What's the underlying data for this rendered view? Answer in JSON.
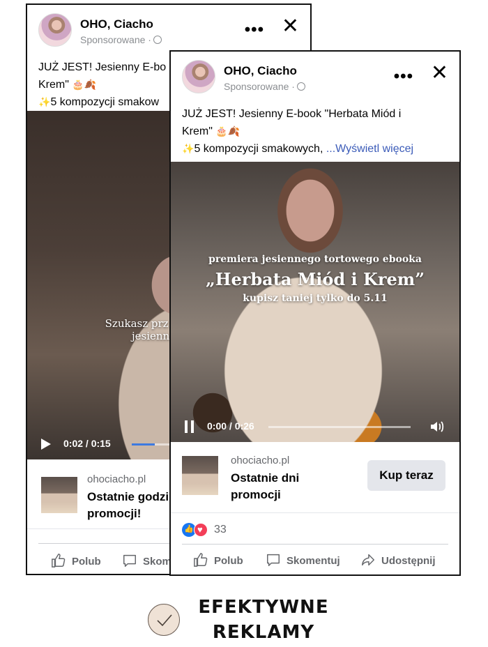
{
  "back_card": {
    "page_name": "OHO, Ciacho",
    "sponsored": "Sponsorowane ·",
    "caption_line1": "JUŻ JEST! Jesienny E-bo",
    "caption_line2": "Krem\"",
    "caption_line3": "5 kompozycji smakow",
    "video_overlay_1": "Szukasz prz",
    "video_overlay_2": "jesienn",
    "video_time": "0:02 / 0:15",
    "video_progress": 0.13,
    "cta_domain": "ohociacho.pl",
    "cta_title": "Ostatnie godzi promocji!",
    "actions": {
      "like": "Polub",
      "comment": "Skom"
    }
  },
  "front_card": {
    "page_name": "OHO, Ciacho",
    "sponsored": "Sponsorowane ·",
    "caption_line1": "JUŻ JEST! Jesienny E-book \"Herbata Miód i",
    "caption_line2": "Krem\"",
    "caption_line3": "5 kompozycji smakowych,",
    "see_more": "...Wyświetl więcej",
    "video_overlay_1": "premiera jesiennego tortowego ebooka",
    "video_overlay_2": "„Herbata Miód i Krem”",
    "video_overlay_3": "kupisz taniej tylko do 5.11",
    "video_time": "0:00 / 0:26",
    "video_progress": 0.0,
    "cta_domain": "ohociacho.pl",
    "cta_title": "Ostatnie dni promocji",
    "cta_button": "Kup teraz",
    "reaction_count": "33",
    "actions": {
      "like": "Polub",
      "comment": "Skomentuj",
      "share": "Udostępnij"
    }
  },
  "emoji": {
    "cake": "🎂",
    "leaf": "🍂",
    "sparkles": "✨"
  },
  "footer": {
    "tagline_line1": "EFEKTYWNE",
    "tagline_line2": "REKLAMY"
  },
  "colors": {
    "link": "#3b5bb8",
    "like_blue": "#1877f2",
    "love_red": "#f33e58",
    "badge_fill": "#efe2d6"
  }
}
